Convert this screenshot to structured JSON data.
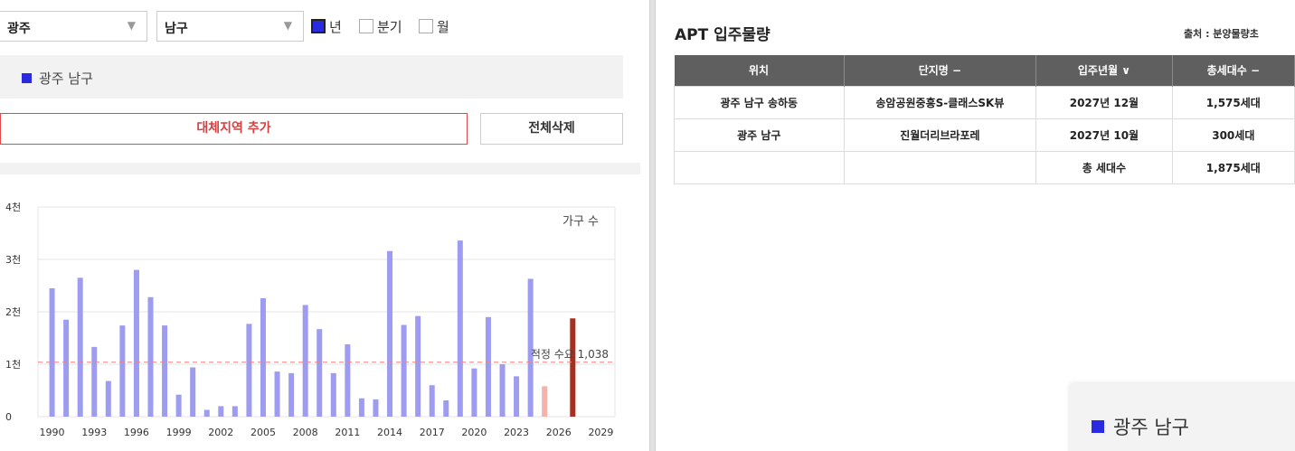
{
  "filters": {
    "region": "광주",
    "district": "남구",
    "period_options": [
      {
        "label": "년",
        "checked": true
      },
      {
        "label": "분기",
        "checked": false
      },
      {
        "label": "월",
        "checked": false
      }
    ]
  },
  "selected_region": "광주 남구",
  "buttons": {
    "add_region": "대체지역 추가",
    "clear_all": "전체삭제"
  },
  "colors": {
    "accent": "#2a2ae0",
    "bar_historic": "#9d9cf0",
    "bar_forecast_light": "#f2b3ab",
    "bar_forecast_dark": "#a5301f",
    "demand_line": "#f08080",
    "table_header": "#5f5f5f"
  },
  "chart_data": {
    "type": "bar",
    "series_label": "가구 수",
    "ylim": [
      0,
      4000
    ],
    "y_ticks": [
      {
        "value": 0,
        "label": "0"
      },
      {
        "value": 1000,
        "label": "1천"
      },
      {
        "value": 2000,
        "label": "2천"
      },
      {
        "value": 3000,
        "label": "3천"
      },
      {
        "value": 4000,
        "label": "4천"
      }
    ],
    "x_range": [
      1989,
      2030
    ],
    "x_ticks": [
      "1990",
      "1993",
      "1996",
      "1999",
      "2002",
      "2005",
      "2008",
      "2011",
      "2014",
      "2017",
      "2020",
      "2023",
      "2026",
      "2029"
    ],
    "bars": [
      {
        "year": 1990,
        "value": 2450,
        "type": "historic"
      },
      {
        "year": 1991,
        "value": 1850,
        "type": "historic"
      },
      {
        "year": 1992,
        "value": 2650,
        "type": "historic"
      },
      {
        "year": 1993,
        "value": 1330,
        "type": "historic"
      },
      {
        "year": 1994,
        "value": 680,
        "type": "historic"
      },
      {
        "year": 1995,
        "value": 1740,
        "type": "historic"
      },
      {
        "year": 1996,
        "value": 2800,
        "type": "historic"
      },
      {
        "year": 1997,
        "value": 2280,
        "type": "historic"
      },
      {
        "year": 1998,
        "value": 1740,
        "type": "historic"
      },
      {
        "year": 1999,
        "value": 420,
        "type": "historic"
      },
      {
        "year": 2000,
        "value": 940,
        "type": "historic"
      },
      {
        "year": 2001,
        "value": 130,
        "type": "historic"
      },
      {
        "year": 2002,
        "value": 200,
        "type": "historic"
      },
      {
        "year": 2003,
        "value": 200,
        "type": "historic"
      },
      {
        "year": 2004,
        "value": 1770,
        "type": "historic"
      },
      {
        "year": 2005,
        "value": 2260,
        "type": "historic"
      },
      {
        "year": 2006,
        "value": 860,
        "type": "historic"
      },
      {
        "year": 2007,
        "value": 830,
        "type": "historic"
      },
      {
        "year": 2008,
        "value": 2130,
        "type": "historic"
      },
      {
        "year": 2009,
        "value": 1670,
        "type": "historic"
      },
      {
        "year": 2010,
        "value": 830,
        "type": "historic"
      },
      {
        "year": 2011,
        "value": 1380,
        "type": "historic"
      },
      {
        "year": 2012,
        "value": 350,
        "type": "historic"
      },
      {
        "year": 2013,
        "value": 330,
        "type": "historic"
      },
      {
        "year": 2014,
        "value": 3160,
        "type": "historic"
      },
      {
        "year": 2015,
        "value": 1750,
        "type": "historic"
      },
      {
        "year": 2016,
        "value": 1920,
        "type": "historic"
      },
      {
        "year": 2017,
        "value": 600,
        "type": "historic"
      },
      {
        "year": 2018,
        "value": 310,
        "type": "historic"
      },
      {
        "year": 2019,
        "value": 3360,
        "type": "historic"
      },
      {
        "year": 2020,
        "value": 920,
        "type": "historic"
      },
      {
        "year": 2021,
        "value": 1900,
        "type": "historic"
      },
      {
        "year": 2022,
        "value": 1000,
        "type": "historic"
      },
      {
        "year": 2023,
        "value": 770,
        "type": "historic"
      },
      {
        "year": 2024,
        "value": 2630,
        "type": "historic"
      },
      {
        "year": 2025,
        "value": 580,
        "type": "forecast-light"
      },
      {
        "year": 2027,
        "value": 1875,
        "type": "forecast-dark"
      }
    ],
    "reference_line": {
      "value": 1038,
      "label": "적정 수요 1,038"
    },
    "grid": true
  },
  "supply": {
    "title": "APT 입주물량",
    "source": "출처 : 분양물량초",
    "columns": [
      "위치",
      "단지명 −",
      "입주년월 ∨",
      "총세대수 −"
    ],
    "rows": [
      [
        "광주 남구 송하동",
        "송암공원중흥S-클래스SK뷰",
        "2027년 12월",
        "1,575세대"
      ],
      [
        "광주 남구",
        "진월더리브라포레",
        "2027년 10월",
        "300세대"
      ],
      [
        "",
        "",
        "총 세대수",
        "1,875세대"
      ]
    ]
  },
  "legend_card": {
    "label": "광주 남구"
  }
}
